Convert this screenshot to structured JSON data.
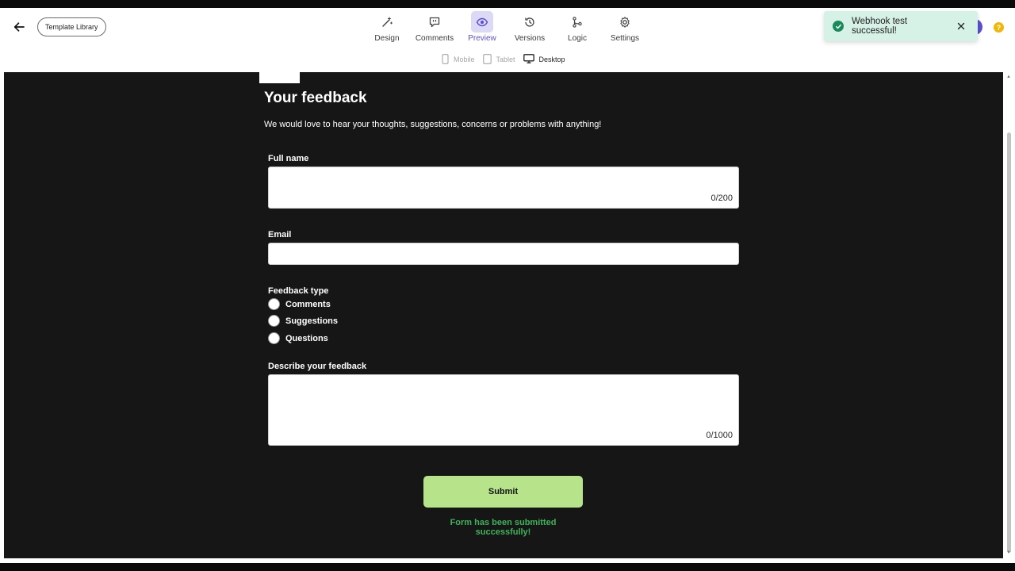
{
  "header": {
    "template_library_label": "Template Library",
    "nav": [
      {
        "label": "Design",
        "icon": "magic-wand-icon"
      },
      {
        "label": "Comments",
        "icon": "comment-icon"
      },
      {
        "label": "Preview",
        "icon": "eye-icon",
        "active": true
      },
      {
        "label": "Versions",
        "icon": "history-icon"
      },
      {
        "label": "Logic",
        "icon": "branch-icon"
      },
      {
        "label": "Settings",
        "icon": "gear-icon"
      }
    ],
    "help_glyph": "?"
  },
  "toast": {
    "message": "Webhook test successful!",
    "status_color": "#1b8a5a"
  },
  "devices": [
    {
      "label": "Mobile",
      "icon": "phone-icon"
    },
    {
      "label": "Tablet",
      "icon": "tablet-icon"
    },
    {
      "label": "Desktop",
      "icon": "monitor-icon",
      "active": true
    }
  ],
  "form": {
    "title": "Your feedback",
    "description": "We would love to hear your thoughts, suggestions, concerns or problems with anything!",
    "full_name": {
      "label": "Full name",
      "value": "",
      "counter": "0/200"
    },
    "email": {
      "label": "Email",
      "value": ""
    },
    "feedback_type": {
      "label": "Feedback type",
      "options": [
        "Comments",
        "Suggestions",
        "Questions"
      ]
    },
    "describe": {
      "label": "Describe your feedback",
      "value": "",
      "counter": "0/1000"
    },
    "submit_label": "Submit",
    "success_message": "Form has been submitted successfully!",
    "accent_color": "#b7e48b",
    "success_color": "#3fb35a"
  }
}
